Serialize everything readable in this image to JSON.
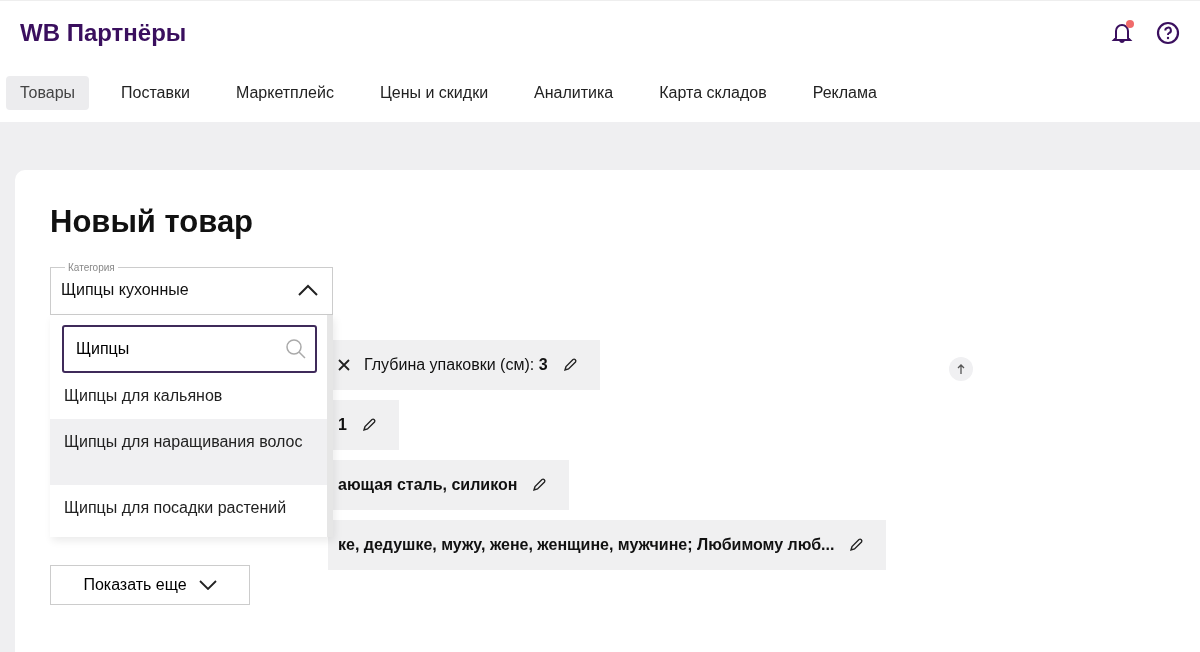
{
  "header": {
    "logo": "WB Партнёры"
  },
  "tabs": [
    {
      "label": "Товары",
      "selected": true
    },
    {
      "label": "Поставки",
      "selected": false
    },
    {
      "label": "Маркетплейс",
      "selected": false
    },
    {
      "label": "Цены и скидки",
      "selected": false
    },
    {
      "label": "Аналитика",
      "selected": false
    },
    {
      "label": "Карта складов",
      "selected": false
    },
    {
      "label": "Реклама",
      "selected": false
    }
  ],
  "page_title": "Новый товар",
  "category_select": {
    "label": "Категория",
    "value": "Щипцы кухонные",
    "expanded": true
  },
  "dropdown": {
    "search_value": "Щипцы",
    "options": [
      {
        "label": "Щипцы для кальянов",
        "hovered": false
      },
      {
        "label": "Щипцы для наращивания волос",
        "hovered": true
      },
      {
        "label": "Щипцы для посадки растений",
        "hovered": false
      }
    ],
    "show_more": "Показать еще"
  },
  "chips": [
    {
      "text": "Глубина упаковки (см): **3**",
      "removable": true
    },
    {
      "text": "**1**",
      "removable": false
    },
    {
      "text": "**ающая сталь, силикон**",
      "removable": false
    },
    {
      "text": "**ке, дедушке, мужу, жене, женщине, мужчине; Любимому люб...**",
      "removable": false
    }
  ]
}
